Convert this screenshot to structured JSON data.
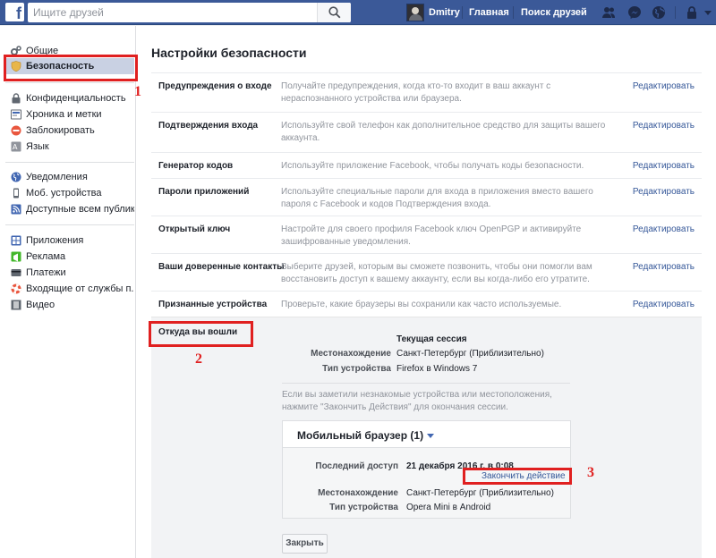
{
  "topbar": {
    "logo": "f",
    "search_placeholder": "Ищите друзей",
    "user_name": "Dmitry",
    "nav_home": "Главная",
    "nav_find_friends": "Поиск друзей",
    "icons": [
      "friend-requests-icon",
      "messenger-icon",
      "notifications-globe-icon",
      "privacy-lock-icon",
      "dropdown-caret-icon"
    ],
    "brand_color": "#3b5998"
  },
  "sidebar": {
    "items": [
      {
        "label": "Общие",
        "icon": "gear-icon",
        "color": "#606770"
      },
      {
        "label": "Безопасность",
        "icon": "shield-icon",
        "color": "#e8b64a"
      },
      {
        "label": "Конфиденциальность",
        "icon": "lock-icon",
        "color": "#606770"
      },
      {
        "label": "Хроника и метки",
        "icon": "timeline-icon",
        "color": "#4267b2"
      },
      {
        "label": "Заблокировать",
        "icon": "block-icon",
        "color": "#e9573f"
      },
      {
        "label": "Язык",
        "icon": "language-icon",
        "color": "#606770"
      },
      {
        "label": "Уведомления",
        "icon": "globe-icon",
        "color": "#4267b2"
      },
      {
        "label": "Моб. устройства",
        "icon": "mobile-icon",
        "color": "#606770"
      },
      {
        "label": "Доступные всем публик...",
        "icon": "rss-icon",
        "color": "#4267b2"
      },
      {
        "label": "Приложения",
        "icon": "apps-icon",
        "color": "#4267b2"
      },
      {
        "label": "Реклама",
        "icon": "ads-icon",
        "color": "#42b72a"
      },
      {
        "label": "Платежи",
        "icon": "card-icon",
        "color": "#606770"
      },
      {
        "label": "Входящие от службы п...",
        "icon": "lifebuoy-icon",
        "color": "#e9573f"
      },
      {
        "label": "Видео",
        "icon": "film-icon",
        "color": "#606770"
      }
    ]
  },
  "annotations": [
    "1",
    "2",
    "3"
  ],
  "annotation_color": "#e02020",
  "main": {
    "title": "Настройки безопасности",
    "edit_label": "Редактировать",
    "rows": [
      {
        "label": "Предупреждения о входе",
        "desc": "Получайте предупреждения, когда кто-то входит в ваш аккаунт с нераспознанного устройства или браузера."
      },
      {
        "label": "Подтверждения входа",
        "desc": "Используйте свой телефон как дополнительное средство для защиты вашего аккаунта."
      },
      {
        "label": "Генератор кодов",
        "desc": "Используйте приложение Facebook, чтобы получать коды безопасности."
      },
      {
        "label": "Пароли приложений",
        "desc": "Используйте специальные пароли для входа в приложения вместо вашего пароля с Facebook и кодов Подтверждения входа."
      },
      {
        "label": "Открытый ключ",
        "desc": "Настройте для своего профиля Facebook ключ OpenPGP и активируйте зашифрованные уведомления."
      },
      {
        "label": "Ваши доверенные контакты",
        "desc": "Выберите друзей, которым вы сможете позвонить, чтобы они помогли вам восстановить доступ к вашему аккаунту, если вы когда-либо его утратите."
      },
      {
        "label": "Признанные устройства",
        "desc": "Проверьте, какие браузеры вы сохранили как часто используемые."
      }
    ],
    "sessions": {
      "label": "Откуда вы вошли",
      "current_title": "Текущая сессия",
      "location_key": "Местонахождение",
      "location_val": "Санкт-Петербург (Приблизительно)",
      "device_key": "Тип устройства",
      "device_val": "Firefox в Windows 7",
      "hint": "Если вы заметили незнакомые устройства или местоположения, нажмите \"Закончить Действия\" для окончания сессии.",
      "mobile_title": "Мобильный браузер (1)",
      "last_access_key": "Последний доступ",
      "last_access_val": "21 декабря 2016 г. в 0:08",
      "end_action": "Закончить действие",
      "m_location_key": "Местонахождение",
      "m_location_val": "Санкт-Петербург (Приблизительно)",
      "m_device_key": "Тип устройства",
      "m_device_val": "Opera Mini в Android",
      "close_button": "Закрыть"
    }
  }
}
